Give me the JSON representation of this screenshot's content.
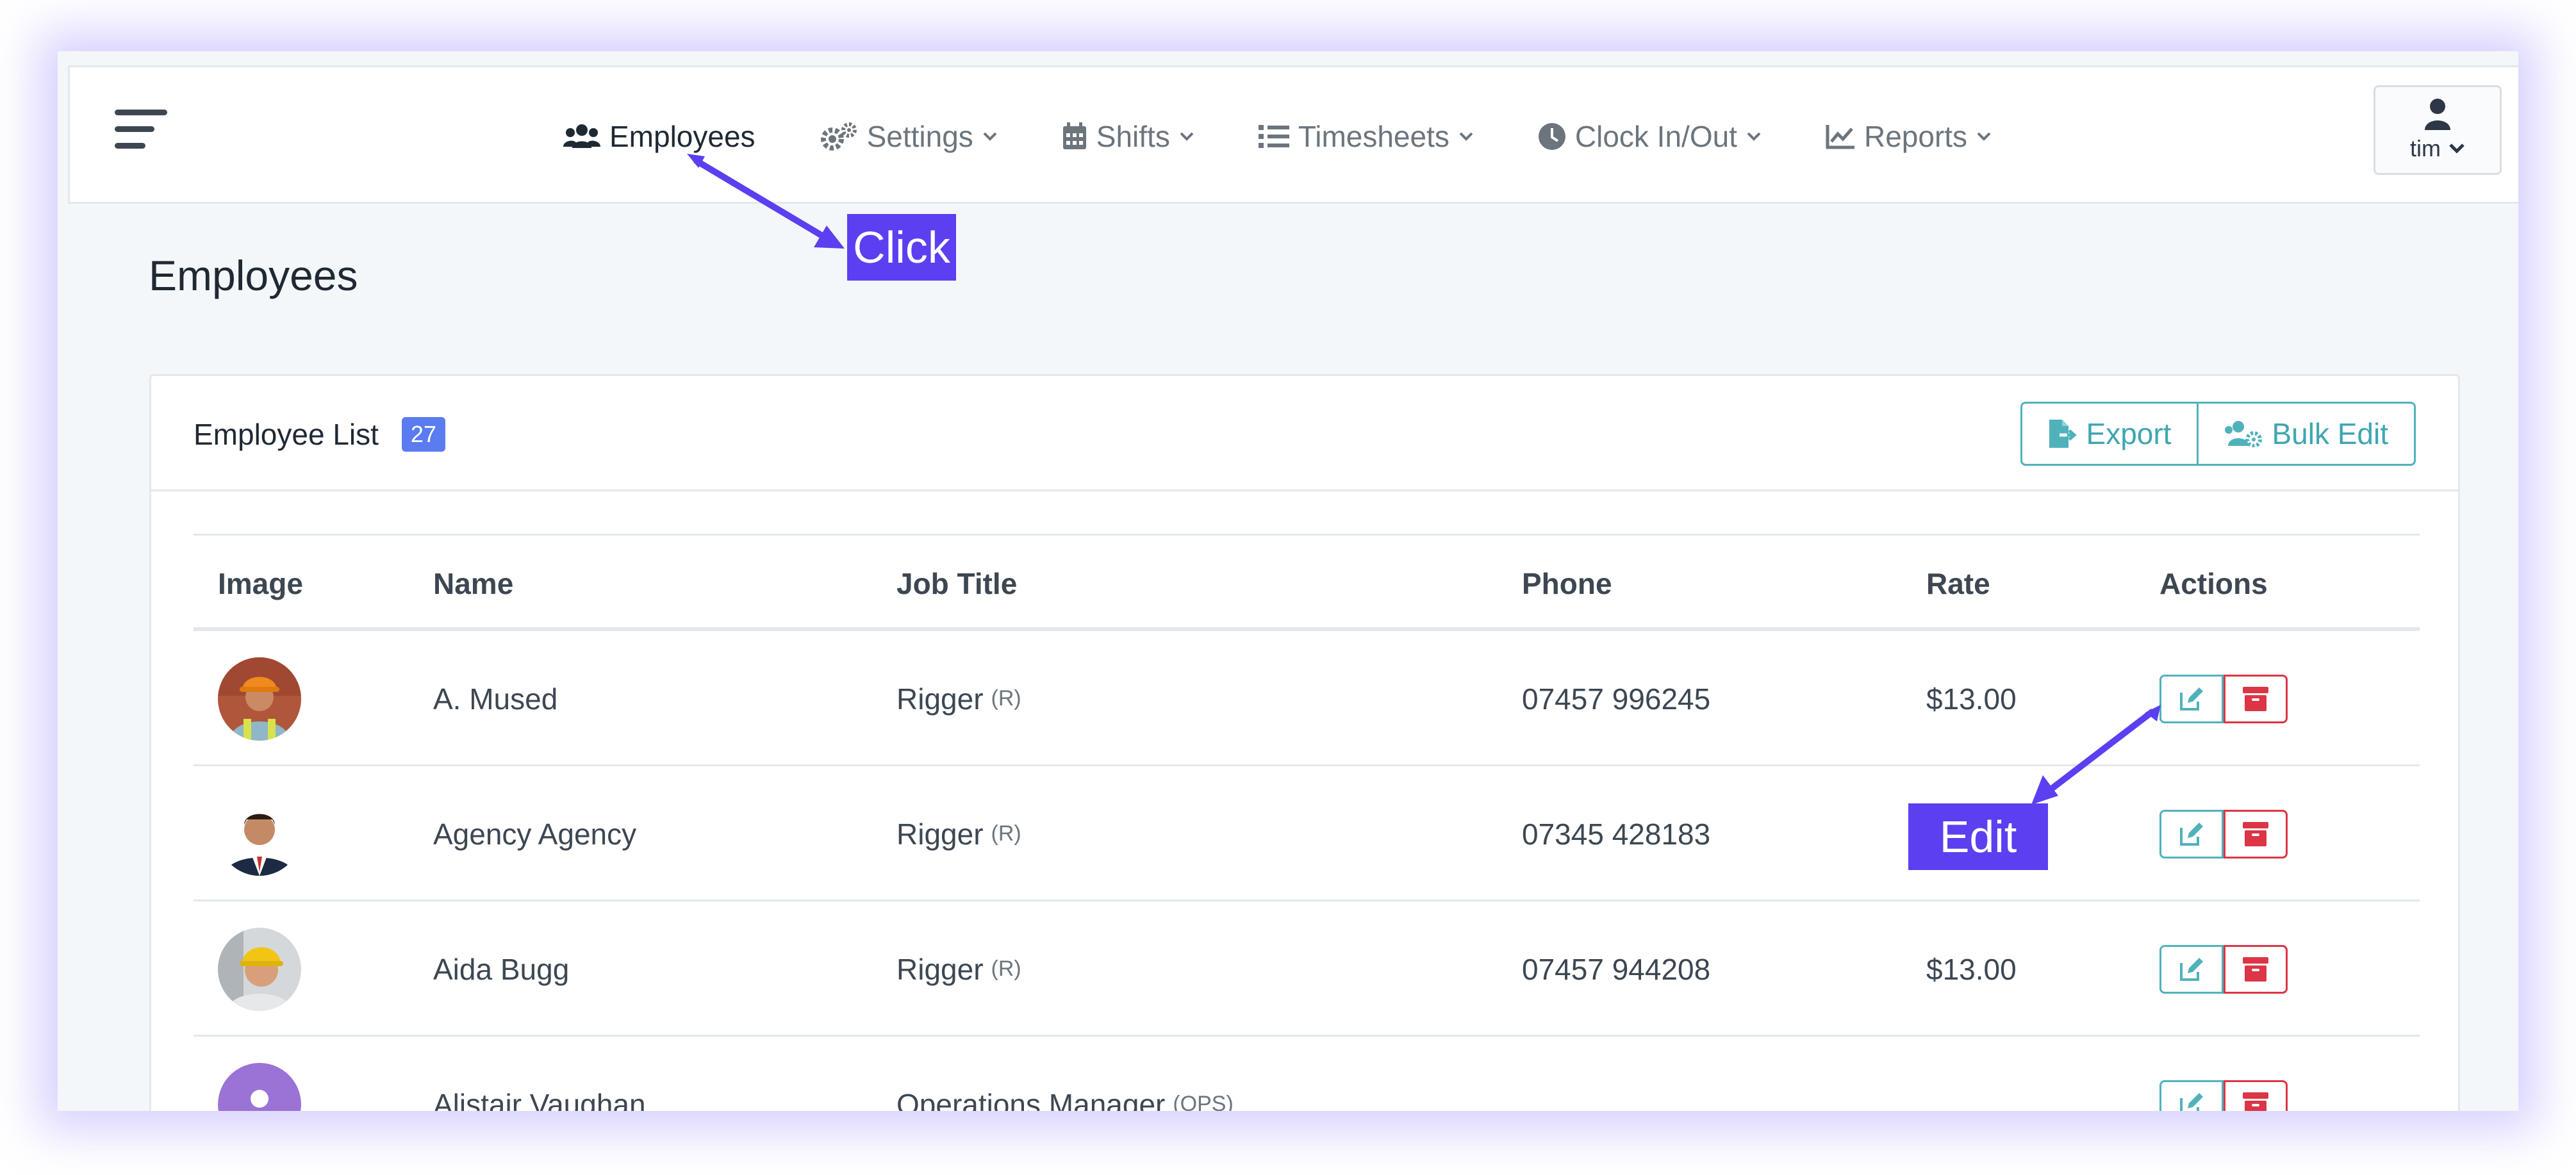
{
  "nav": {
    "items": [
      {
        "label": "Employees",
        "icon": "users-icon",
        "active": true,
        "dropdown": false
      },
      {
        "label": "Settings",
        "icon": "cogs-icon",
        "active": false,
        "dropdown": true
      },
      {
        "label": "Shifts",
        "icon": "calendar-icon",
        "active": false,
        "dropdown": true
      },
      {
        "label": "Timesheets",
        "icon": "list-icon",
        "active": false,
        "dropdown": true
      },
      {
        "label": "Clock In/Out",
        "icon": "clock-icon",
        "active": false,
        "dropdown": true
      },
      {
        "label": "Reports",
        "icon": "chart-line-icon",
        "active": false,
        "dropdown": true
      }
    ]
  },
  "user": {
    "name": "tim"
  },
  "page": {
    "title": "Employees"
  },
  "card": {
    "title": "Employee List",
    "count": "27",
    "export_label": "Export",
    "bulk_edit_label": "Bulk Edit"
  },
  "table": {
    "headers": [
      "Image",
      "Name",
      "Job Title",
      "Phone",
      "Rate",
      "Actions"
    ],
    "rows": [
      {
        "name": "A. Mused",
        "job": "Rigger",
        "code": "(R)",
        "phone": "07457 996245",
        "rate": "$13.00",
        "avatar": "worker-hardhat-orange"
      },
      {
        "name": "Agency Agency",
        "job": "Rigger",
        "code": "(R)",
        "phone": "07345 428183",
        "rate": "",
        "avatar": "man-suit"
      },
      {
        "name": "Aida Bugg",
        "job": "Rigger",
        "code": "(R)",
        "phone": "07457 944208",
        "rate": "$13.00",
        "avatar": "worker-hardhat-yellow"
      },
      {
        "name": "Alistair Vaughan",
        "job": "Operations Manager",
        "code": "(OPS)",
        "phone": "",
        "rate": "",
        "avatar": "placeholder-user"
      }
    ]
  },
  "annotations": {
    "click_label": "Click",
    "edit_label": "Edit"
  },
  "colors": {
    "accent": "#5b3ff0",
    "teal": "#4fb2bb",
    "danger": "#dc3545",
    "badge": "#5b7bf0"
  }
}
